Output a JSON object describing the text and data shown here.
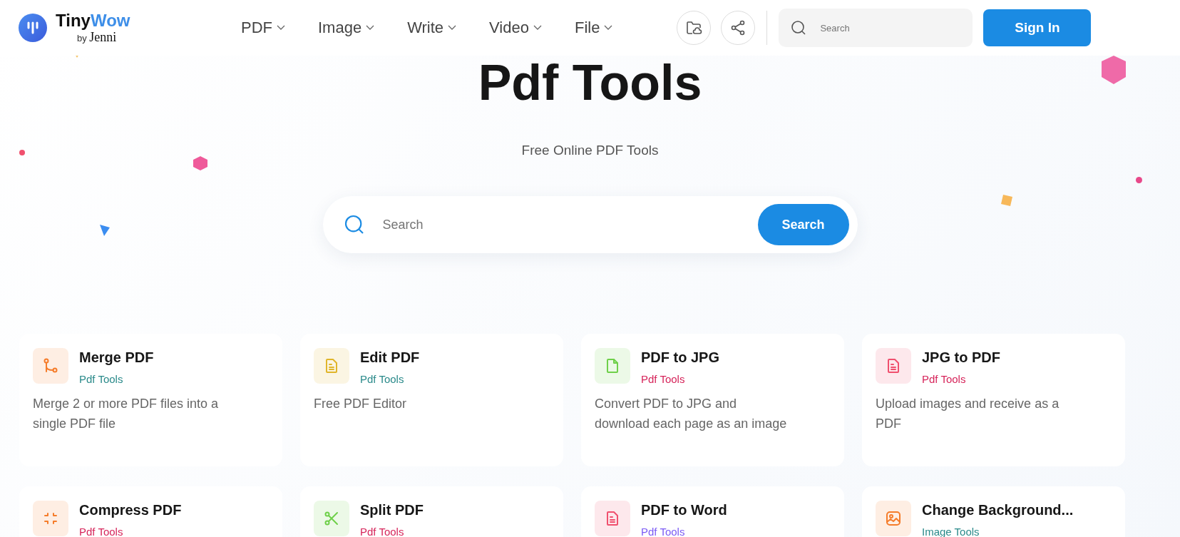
{
  "header": {
    "logo": {
      "name_a": "Tiny",
      "name_b": "Wow",
      "by": "by",
      "brand": "Jenni"
    },
    "nav": [
      {
        "label": "PDF"
      },
      {
        "label": "Image"
      },
      {
        "label": "Write"
      },
      {
        "label": "Video"
      },
      {
        "label": "File"
      }
    ],
    "search": {
      "placeholder": "Search"
    },
    "sign_in": "Sign In"
  },
  "hero": {
    "title": "Pdf Tools",
    "subtitle": "Free Online PDF Tools",
    "search": {
      "placeholder": "Search",
      "button": "Search"
    }
  },
  "tools": [
    {
      "title": "Merge PDF",
      "tag": "Pdf Tools",
      "color": "#2a8a8a",
      "kind": "merge",
      "description": "Merge 2 or more PDF files into a single PDF file"
    },
    {
      "title": "Edit PDF",
      "tag": "Pdf Tools",
      "color": "#2a8a8a",
      "kind": "edit",
      "description": "Free PDF Editor"
    },
    {
      "title": "PDF to JPG",
      "tag": "Pdf Tools",
      "color": "#d6245a",
      "kind": "convert",
      "description": "Convert PDF to JPG and download each page as an image"
    },
    {
      "title": "JPG to PDF",
      "tag": "Pdf Tools",
      "color": "#d6245a",
      "kind": "document",
      "description": "Upload images and receive as a PDF"
    },
    {
      "title": "Compress PDF",
      "tag": "Pdf Tools",
      "color": "#d6245a",
      "kind": "compress"
    },
    {
      "title": "Split PDF",
      "tag": "Pdf Tools",
      "color": "#d6245a",
      "kind": "split"
    },
    {
      "title": "PDF to Word",
      "tag": "Pdf Tools",
      "color": "#7a5af5",
      "kind": "document"
    },
    {
      "title": "Change Background...",
      "tag": "Image Tools",
      "color": "#2a8a8a",
      "kind": "image"
    }
  ]
}
